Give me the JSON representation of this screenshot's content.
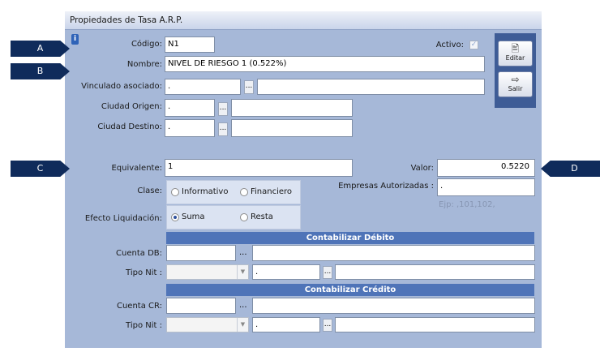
{
  "window": {
    "title": "Propiedades de Tasa A.R.P."
  },
  "callouts": {
    "a": "A",
    "b": "B",
    "c": "C",
    "d": "D"
  },
  "fields": {
    "codigo_label": "Código:",
    "codigo_value": "N1",
    "activo_label": "Activo:",
    "activo_checked": true,
    "nombre_label": "Nombre:",
    "nombre_value": "NIVEL DE RIESGO 1 (0.522%)",
    "vinculado_label": "Vinculado asociado:",
    "vinculado_value": ".",
    "ciudad_origen_label": "Ciudad Origen:",
    "ciudad_origen_value": ".",
    "ciudad_destino_label": "Ciudad Destino:",
    "ciudad_destino_value": ".",
    "equivalente_label": "Equivalente:",
    "equivalente_value": "1",
    "valor_label": "Valor:",
    "valor_value": "0.5220",
    "clase_label": "Clase:",
    "clase_options": [
      "Informativo",
      "Financiero"
    ],
    "empresas_label": "Empresas Autorizadas :",
    "empresas_value": ".",
    "empresas_hint": "Ejp: ,101,102,",
    "efecto_label": "Efecto Liquidación:",
    "efecto_options": [
      "Suma",
      "Resta"
    ],
    "efecto_selected": "Suma"
  },
  "debito": {
    "header": "Contabilizar Débito",
    "cuenta_label": "Cuenta DB:",
    "tiponit_label": "Tipo Nit :",
    "tiponit_value": "."
  },
  "credito": {
    "header": "Contabilizar Crédito",
    "cuenta_label": "Cuenta CR:",
    "tiponit_label": "Tipo Nit :",
    "tiponit_value": "."
  },
  "buttons": {
    "editar": "Editar",
    "salir": "Salir",
    "dots": "..."
  },
  "colors": {
    "panel": "#a6b8d8",
    "callout": "#0f2b5b",
    "section_bar": "#4f74b8"
  }
}
